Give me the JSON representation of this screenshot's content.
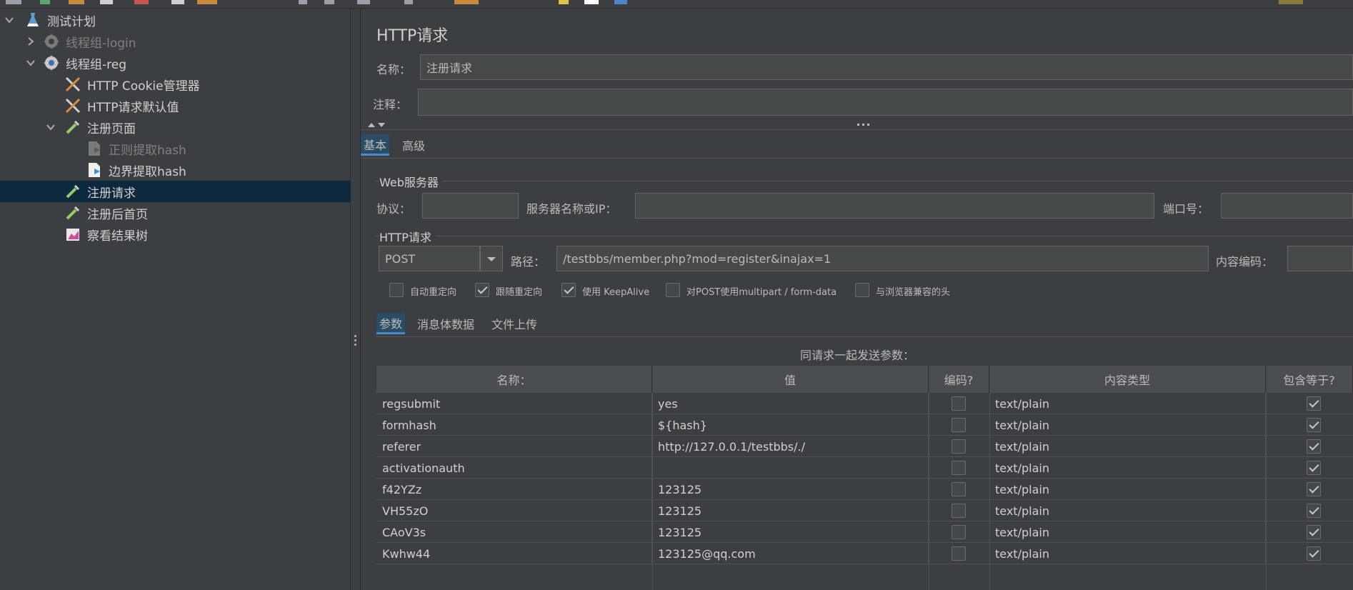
{
  "tree": {
    "items": [
      {
        "label": "测试计划"
      },
      {
        "label": "线程组-login"
      },
      {
        "label": "线程组-reg"
      },
      {
        "label": "HTTP Cookie管理器"
      },
      {
        "label": "HTTP请求默认值"
      },
      {
        "label": "注册页面"
      },
      {
        "label": "正则提取hash"
      },
      {
        "label": "边界提取hash"
      },
      {
        "label": "注册请求"
      },
      {
        "label": "注册后首页"
      },
      {
        "label": "察看结果树"
      }
    ]
  },
  "panel": {
    "title": "HTTP请求",
    "name_label": "名称：",
    "name_value": "注册请求",
    "comment_label": "注释：",
    "comment_value": "",
    "tabs": [
      {
        "label": "基本"
      },
      {
        "label": "高级"
      }
    ],
    "web_server": {
      "section": "Web服务器",
      "protocol_label": "协议：",
      "protocol_value": "",
      "server_label": "服务器名称或IP：",
      "server_value": "",
      "port_label": "端口号：",
      "port_value": ""
    },
    "http_request": {
      "section": "HTTP请求",
      "method": "POST",
      "path_label": "路径：",
      "path_value": "/testbbs/member.php?mod=register&inajax=1",
      "encoding_label": "内容编码：",
      "encoding_value": ""
    },
    "options": [
      {
        "label": "自动重定向",
        "checked": false
      },
      {
        "label": "跟随重定向",
        "checked": true
      },
      {
        "label": "使用 KeepAlive",
        "checked": true
      },
      {
        "label": "对POST使用multipart / form-data",
        "checked": false
      },
      {
        "label": "与浏览器兼容的头",
        "checked": false
      }
    ],
    "sub_tabs": [
      {
        "label": "参数"
      },
      {
        "label": "消息体数据"
      },
      {
        "label": "文件上传"
      }
    ],
    "params_caption": "同请求一起发送参数：",
    "columns": {
      "name": "名称：",
      "value": "值",
      "encode": "编码?",
      "content_type": "内容类型",
      "include_equals": "包含等于?"
    },
    "rows": [
      {
        "name": "regsubmit",
        "value": "yes",
        "encode": false,
        "content_type": "text/plain",
        "include_equals": true
      },
      {
        "name": "formhash",
        "value": "${hash}",
        "encode": false,
        "content_type": "text/plain",
        "include_equals": true
      },
      {
        "name": "referer",
        "value": "http://127.0.0.1/testbbs/./",
        "encode": false,
        "content_type": "text/plain",
        "include_equals": true
      },
      {
        "name": "activationauth",
        "value": "",
        "encode": false,
        "content_type": "text/plain",
        "include_equals": true
      },
      {
        "name": "f42YZz",
        "value": "123125",
        "encode": false,
        "content_type": "text/plain",
        "include_equals": true
      },
      {
        "name": "VH55zO",
        "value": "123125",
        "encode": false,
        "content_type": "text/plain",
        "include_equals": true
      },
      {
        "name": "CAoV3s",
        "value": "123125",
        "encode": false,
        "content_type": "text/plain",
        "include_equals": true
      },
      {
        "name": "Kwhw44",
        "value": "123125@qq.com",
        "encode": false,
        "content_type": "text/plain",
        "include_equals": true
      }
    ]
  }
}
